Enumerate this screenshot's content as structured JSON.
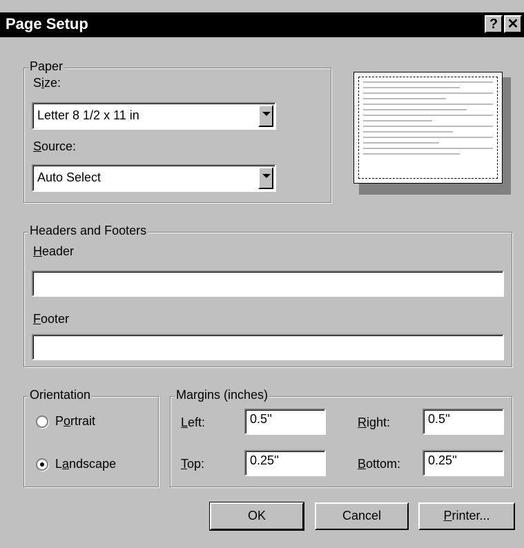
{
  "window": {
    "title": "Page Setup",
    "help_label": "?",
    "close_label": "✕"
  },
  "paper": {
    "legend": "Paper",
    "size": {
      "label_pre": "S",
      "label_u": "i",
      "label_post": "ze:",
      "value": "Letter 8 1/2 x 11 in"
    },
    "source": {
      "label_u": "S",
      "label_post": "ource:",
      "value": "Auto Select"
    }
  },
  "headers_footers": {
    "legend": "Headers and Footers",
    "header": {
      "label_u": "H",
      "label_post": "eader",
      "value": ""
    },
    "footer": {
      "label_u": "F",
      "label_post": "ooter",
      "value": ""
    }
  },
  "orientation": {
    "legend": "Orientation",
    "portrait": {
      "label_pre": "P",
      "label_u": "o",
      "label_post": "rtrait",
      "selected": false
    },
    "landscape": {
      "label_pre": "L",
      "label_u": "a",
      "label_post": "ndscape",
      "selected": true
    }
  },
  "margins": {
    "legend": "Margins (inches)",
    "left": {
      "label_u": "L",
      "label_post": "eft:",
      "value": "0.5''"
    },
    "right": {
      "label_u": "R",
      "label_post": "ight:",
      "value": "0.5''"
    },
    "top": {
      "label_u": "T",
      "label_post": "op:",
      "value": "0.25''"
    },
    "bottom": {
      "label_u": "B",
      "label_post": "ottom:",
      "value": "0.25''"
    }
  },
  "buttons": {
    "ok": "OK",
    "cancel": "Cancel",
    "printer_u": "P",
    "printer_post": "rinter..."
  }
}
